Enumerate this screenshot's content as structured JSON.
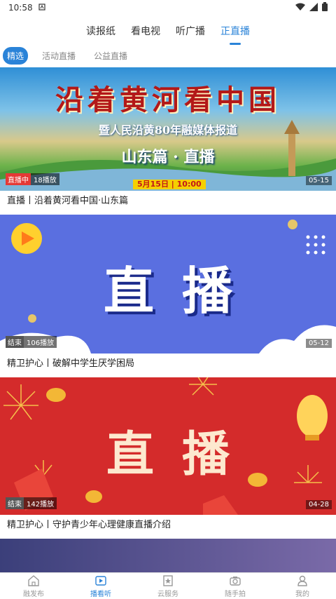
{
  "status": {
    "time": "10:58"
  },
  "main_tabs": [
    "读报纸",
    "看电视",
    "听广播",
    "正直播"
  ],
  "sub_tabs": [
    "精选",
    "活动直播",
    "公益直播"
  ],
  "cards": [
    {
      "banner": {
        "headline": "沿着黄河看中国",
        "subline": "暨人民沿黄80年融媒体报道",
        "section": "山东篇 · 直播",
        "schedule": "5月15日 | 10:00"
      },
      "state": "直播中",
      "plays": "18播放",
      "date": "05-15",
      "title": "直播丨沿着黄河看中国·山东篇"
    },
    {
      "banner": {
        "headline": "直播"
      },
      "state": "结束",
      "plays": "106播放",
      "date": "05-12",
      "title": "精卫护心丨破解中学生厌学困局"
    },
    {
      "banner": {
        "headline": "直播"
      },
      "state": "结束",
      "plays": "142播放",
      "date": "04-28",
      "title": "精卫护心丨守护青少年心理健康直播介绍"
    }
  ],
  "bottom_nav": [
    {
      "label": "融发布",
      "icon": "home-icon"
    },
    {
      "label": "播看听",
      "icon": "play-icon"
    },
    {
      "label": "云服务",
      "icon": "star-icon"
    },
    {
      "label": "随手拍",
      "icon": "camera-icon"
    },
    {
      "label": "我的",
      "icon": "person-icon"
    }
  ],
  "colors": {
    "accent": "#2a83d8",
    "live_red": "#e53935",
    "blue_banner": "#5a6fe0",
    "red_banner": "#d42b2b"
  }
}
